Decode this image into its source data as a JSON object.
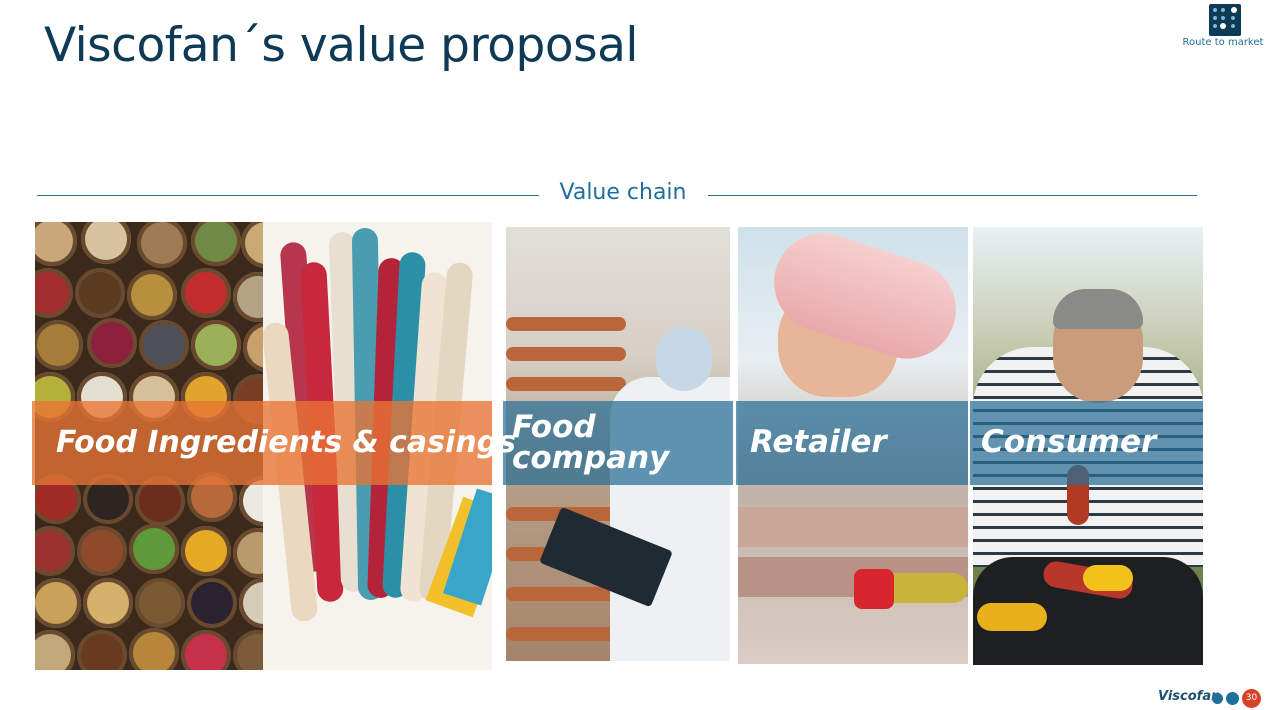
{
  "header": {
    "title": "Viscofan´s value proposal",
    "corner_label": "Route to market"
  },
  "section": {
    "label": "Value chain"
  },
  "chain": [
    {
      "label": "Food Ingredients & casings"
    },
    {
      "label_line1": "Food",
      "label_line2": "company"
    },
    {
      "label": "Retailer"
    },
    {
      "label": "Consumer"
    }
  ],
  "footer": {
    "logo_text": "Viscofan",
    "page_number": "30"
  },
  "colors": {
    "title": "#0e3a55",
    "accent": "#1d6f9c",
    "orange_band": "#e87434",
    "blue_band": "#286e96",
    "page_badge": "#d9422a"
  }
}
